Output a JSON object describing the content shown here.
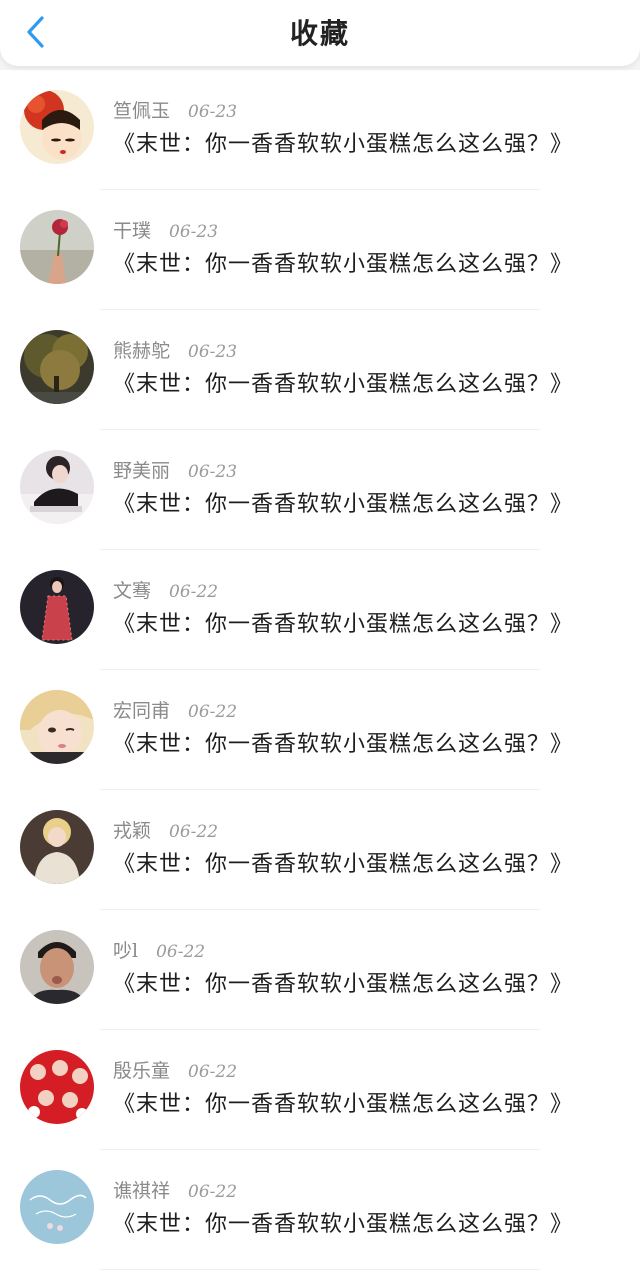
{
  "header": {
    "title": "收藏",
    "back_icon": "chevron-left-icon",
    "accent": "#2f9bf0"
  },
  "items": [
    {
      "name": "笪佩玉",
      "date": "06-23",
      "book": "《末世：你一香香软软小蛋糕怎么这么强？》",
      "avatar": "avatar-woman-red-flower"
    },
    {
      "name": "干璞",
      "date": "06-23",
      "book": "《末世：你一香香软软小蛋糕怎么这么强？》",
      "avatar": "avatar-hand-rose"
    },
    {
      "name": "熊赫鸵",
      "date": "06-23",
      "book": "《末世：你一香香软软小蛋糕怎么这么强？》",
      "avatar": "avatar-tree"
    },
    {
      "name": "野美丽",
      "date": "06-23",
      "book": "《末世：你一香香软软小蛋糕怎么这么强？》",
      "avatar": "avatar-girl-writing"
    },
    {
      "name": "文骞",
      "date": "06-22",
      "book": "《末世：你一香香软软小蛋糕怎么这么强？》",
      "avatar": "avatar-girl-red-dress"
    },
    {
      "name": "宏同甫",
      "date": "06-22",
      "book": "《末世：你一香香软软小蛋糕怎么这么强？》",
      "avatar": "avatar-blonde-wink"
    },
    {
      "name": "戎颖",
      "date": "06-22",
      "book": "《末世：你一香香软软小蛋糕怎么这么强？》",
      "avatar": "avatar-blonde-hat"
    },
    {
      "name": "吵l",
      "date": "06-22",
      "book": "《末世：你一香香软软小蛋糕怎么这么强？》",
      "avatar": "avatar-man-kiss"
    },
    {
      "name": "殷乐童",
      "date": "06-22",
      "book": "《末世：你一香香软软小蛋糕怎么这么强？》",
      "avatar": "avatar-red-group"
    },
    {
      "name": "谯祺祥",
      "date": "06-22",
      "book": "《末世：你一香香软软小蛋糕怎么这么强？》",
      "avatar": "avatar-blue-script"
    }
  ]
}
